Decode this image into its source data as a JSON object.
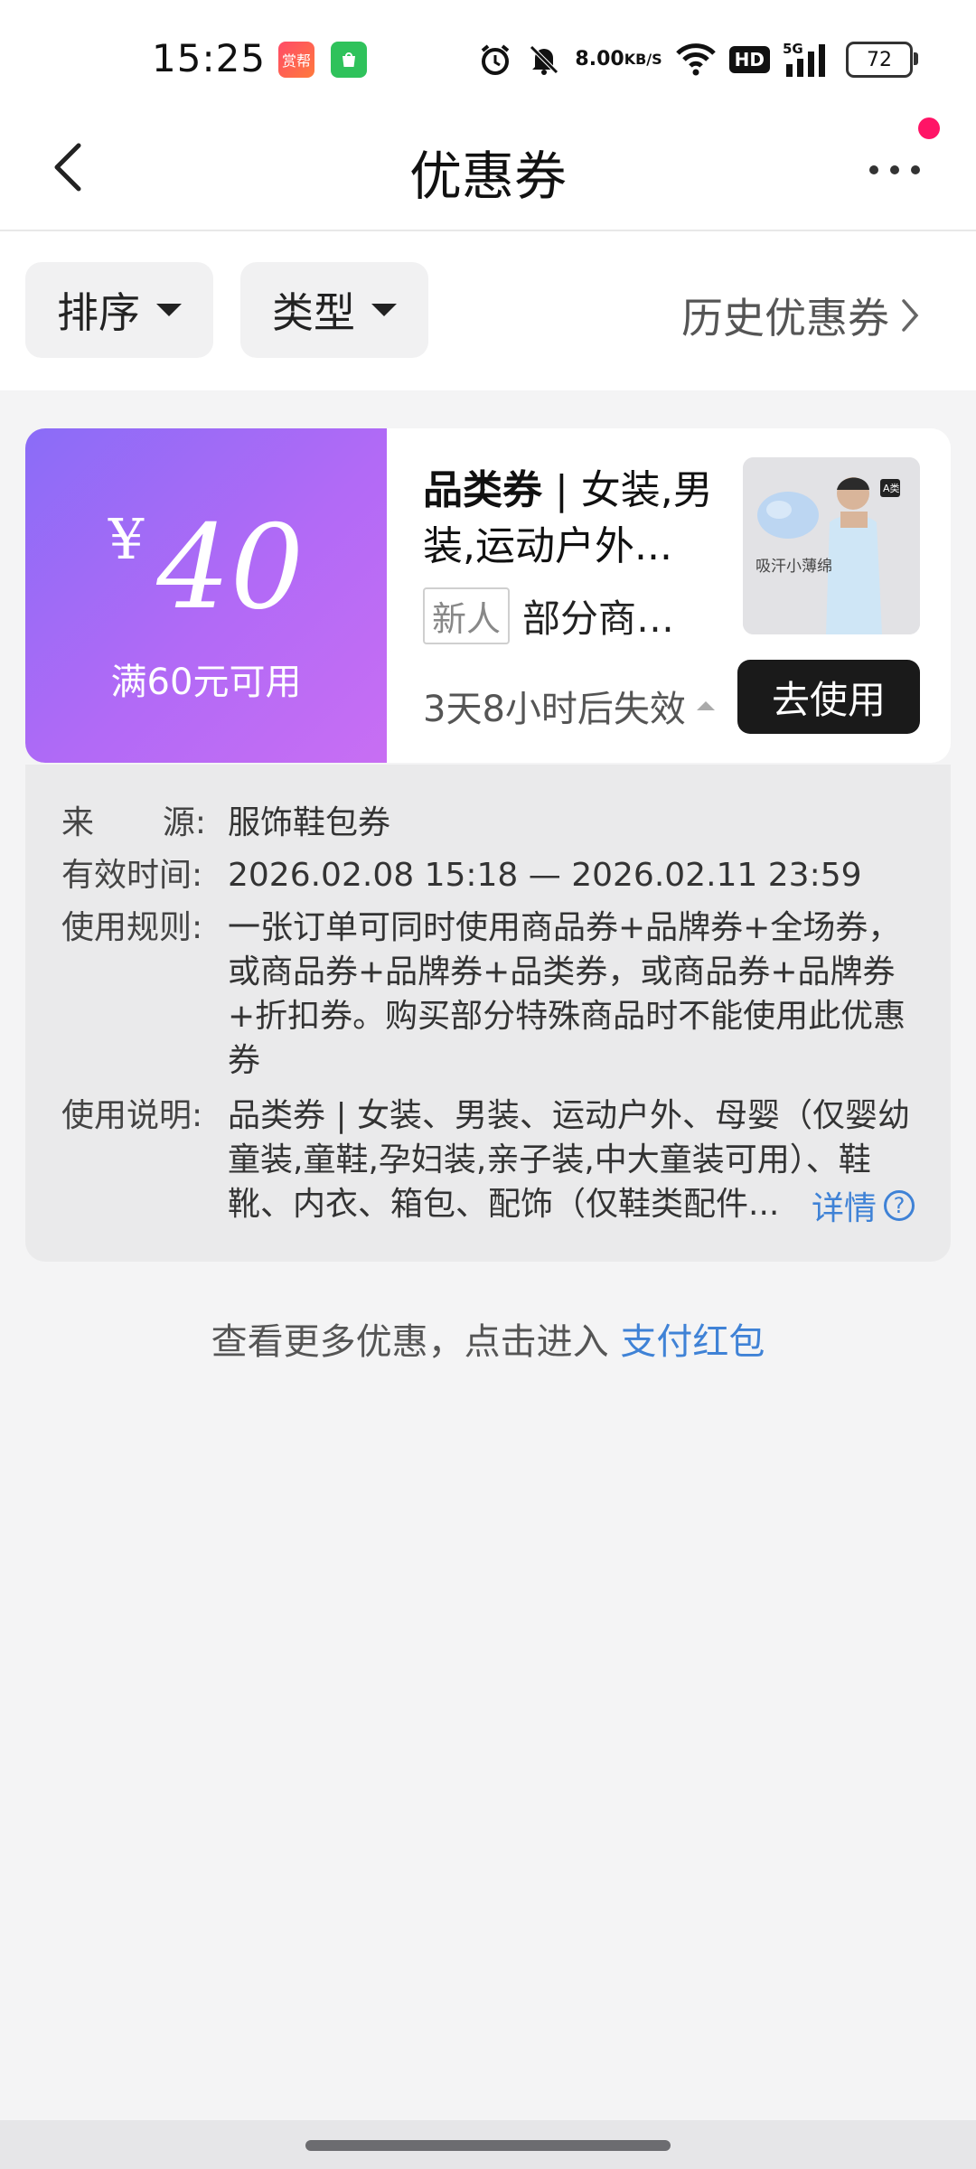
{
  "status_bar": {
    "time": "15:25",
    "app_badge_1": "赏帮",
    "app_badge_2": "",
    "net_speed_value": "8.00",
    "net_speed_unit": "KB/S",
    "hd": "HD",
    "network": "5G",
    "battery": "72"
  },
  "header": {
    "title": "优惠券"
  },
  "filters": {
    "sort_label": "排序",
    "type_label": "类型",
    "history_label": "历史优惠券"
  },
  "coupon": {
    "currency": "¥",
    "amount": "40",
    "condition": "满60元可用",
    "title_bold": "品类券",
    "title_rest": " | 女装,男装,运动户外...",
    "tag": "新人",
    "scope": "部分商品...",
    "expire": "3天8小时后失效",
    "use_button": "去使用",
    "thumb_text_1": "吸汗小薄绵",
    "thumb_tag": "A类"
  },
  "details": {
    "source_label_1": "来",
    "source_label_2": "源:",
    "source_value": "服饰鞋包券",
    "time_label": "有效时间:",
    "time_value": "2026.02.08 15:18 — 2026.02.11 23:59",
    "rule_label": "使用规则:",
    "rule_value": "一张订单可同时使用商品券+品牌券+全场券，或商品券+品牌券+品类券，或商品券+品牌券+折扣券。购买部分特殊商品时不能使用此优惠券",
    "note_label": "使用说明:",
    "note_value": "品类券 | 女装、男装、运动户外、母婴（仅婴幼童装,童鞋,孕妇装,亲子装,中大童装可用）、鞋靴、内衣、箱包、配饰（仅鞋类配件...",
    "more_label": "详情",
    "more_icon": "?"
  },
  "promo": {
    "text": "查看更多优惠，点击进入 ",
    "link": "支付红包"
  },
  "colors": {
    "coupon_gradient_start": "#8a6cf7",
    "coupon_gradient_end": "#c86ef3",
    "link": "#3f82d6",
    "notification_dot": "#ff1466"
  }
}
